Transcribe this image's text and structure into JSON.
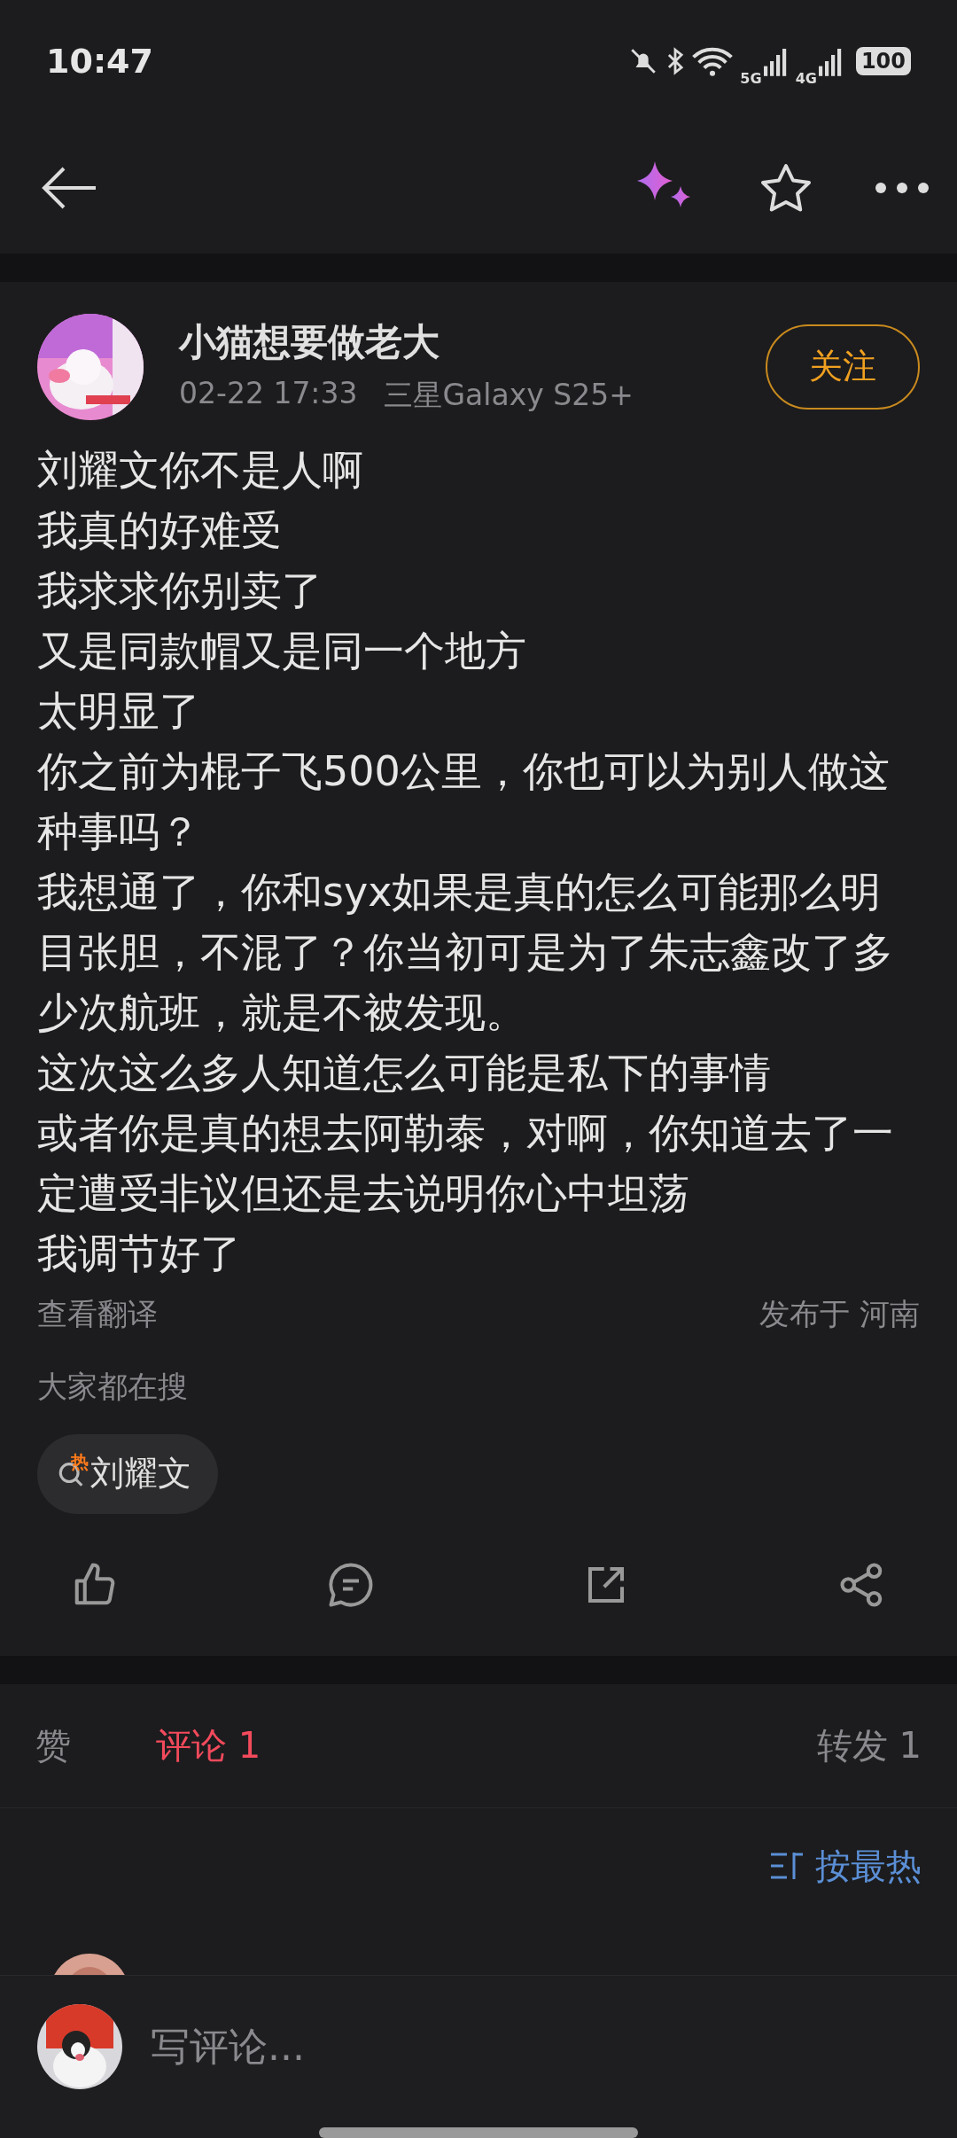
{
  "status_bar": {
    "time": "10:47",
    "network_1": "5G",
    "network_2": "4G",
    "battery": "100"
  },
  "post": {
    "author": "小猫想要做老大",
    "time": "02-22 17:33",
    "device": "三星Galaxy S25+",
    "follow_button": "关注",
    "paragraphs": [
      "刘耀文你不是人啊",
      "我真的好难受",
      "我求求你别卖了",
      "又是同款帽又是同一个地方",
      "太明显了",
      "你之前为棍子飞500公里，你也可以为别人做这种事吗？",
      "我想通了，你和syx如果是真的怎么可能那么明目张胆，不混了？你当初可是为了朱志鑫改了多少次航班，就是不被发现。",
      "这次这么多人知道怎么可能是私下的事情",
      "或者你是真的想去阿勒泰，对啊，你知道去了一定遭受非议但还是去说明你心中坦荡",
      "我调节好了"
    ],
    "translate_link": "查看翻译",
    "location": "发布于 河南",
    "trending_label": "大家都在搜",
    "trending_tags": [
      {
        "badge": "热",
        "text": "刘耀文"
      }
    ]
  },
  "tabs": [
    {
      "label": "赞",
      "selected": false
    },
    {
      "label": "评论 1",
      "selected": true
    },
    {
      "label": "转发 1",
      "selected": false
    }
  ],
  "sort_button": "按最热",
  "comment_box": {
    "placeholder": "写评论..."
  }
}
